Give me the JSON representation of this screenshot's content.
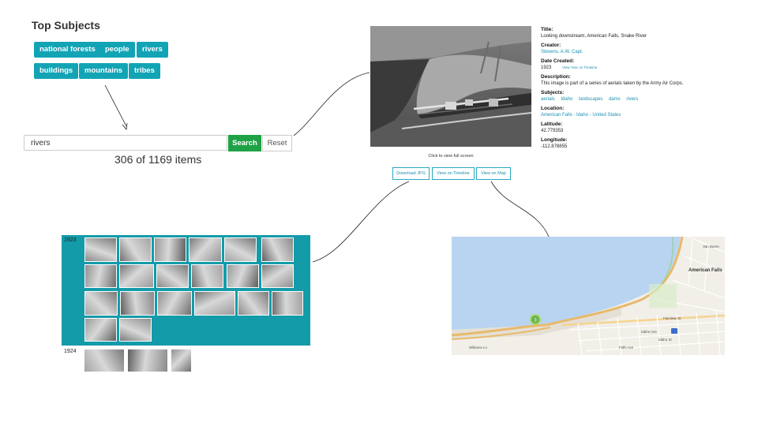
{
  "subjects": {
    "title": "Top Subjects",
    "tags": [
      "national forests",
      "people",
      "rivers",
      "buildings",
      "mountains",
      "tribes"
    ]
  },
  "search": {
    "value": "rivers",
    "search_label": "Search",
    "reset_label": "Reset",
    "count_text": "306 of 1169 items"
  },
  "detail": {
    "caption": "Click to view full screen",
    "buttons": [
      "Download JPG",
      "View on Timeline",
      "View on Map"
    ],
    "title_label": "Title:",
    "title": "Looking downstream, American Falls, Snake River",
    "creator_label": "Creator:",
    "creator": "Stevens, A.W. Capt.",
    "date_label": "Date Created:",
    "date": "1923",
    "date_link": "View Year on Timeline",
    "description_label": "Description:",
    "description": "This image is part of a series of aerials taken by the Army Air Corps.",
    "subjects_label": "Subjects:",
    "subjects": [
      "aerials",
      "Idaho",
      "landscapes",
      "dams",
      "rivers"
    ],
    "location_label": "Location:",
    "location": "American Falls - Idaho - United States",
    "latitude_label": "Latitude:",
    "latitude": "42.779353",
    "longitude_label": "Longitude:",
    "longitude": "-112.878855"
  },
  "timeline": {
    "year_1923": "1923",
    "year_1924": "1924"
  },
  "map": {
    "cluster_count": "3",
    "labels": {
      "american_falls": "American Falls",
      "williams_ln": "Williams Ln",
      "falls_ave": "Falls Ave",
      "idaho_st": "Idaho St",
      "fairview_st": "Fairview St",
      "van_buren": "Van Buren",
      "idaho_ave": "Idaho Ave"
    }
  },
  "colors": {
    "tag_bg": "#12a4b5",
    "search_btn": "#1fa246",
    "timeline_bg": "#149ba9",
    "link": "#1c8fb0",
    "water": "#b9d4f0"
  }
}
